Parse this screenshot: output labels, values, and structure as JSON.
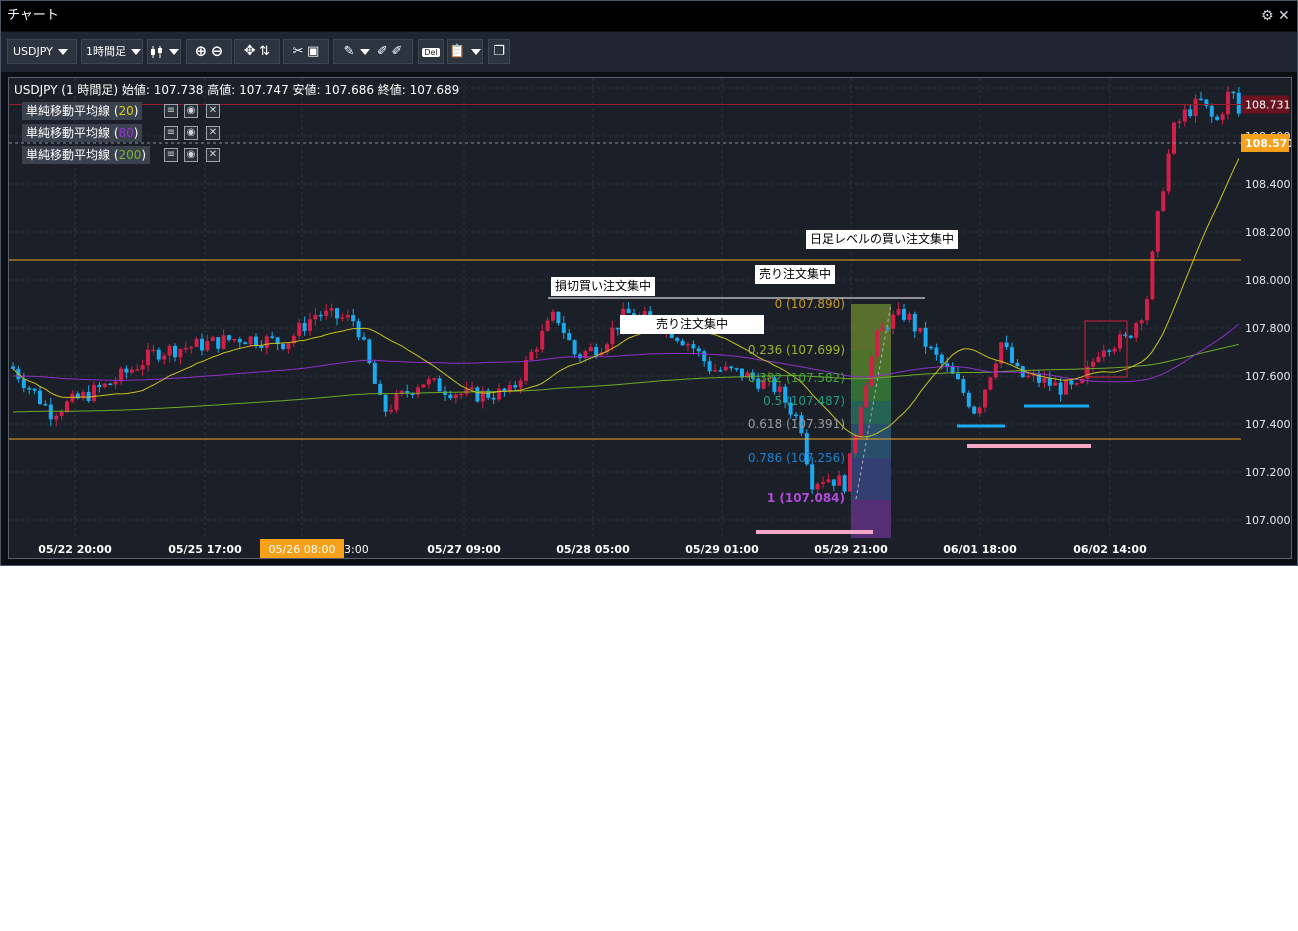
{
  "window": {
    "title": "チャート",
    "gear_icon": "gear-icon",
    "close_icon": "close-icon"
  },
  "toolbar": {
    "symbol": "USDJPY",
    "timeframe": "1時間足",
    "chart_type_icon": "candlestick-icon",
    "buttons": [
      "zoom-in-icon",
      "zoom-out-icon",
      "pan-icon",
      "crosshair-icon",
      "drawing-tool-icon",
      "save-icon",
      "pen-icon",
      "eraser-icon",
      "eraser-all-icon",
      "delete-icon",
      "clipboard-icon",
      "window-icon"
    ],
    "delete_label": "Del"
  },
  "chart": {
    "header": "USDJPY (1 時間足) 始値: 107.738 高値: 107.747 安値: 107.686 終値: 107.689",
    "indicators": [
      {
        "name": "単純移動平均線",
        "period": "20",
        "color": "#e0d000"
      },
      {
        "name": "単純移動平均線",
        "period": "80",
        "color": "#9b30d9"
      },
      {
        "name": "単純移動平均線",
        "period": "200",
        "color": "#7ab52a"
      }
    ],
    "price_labels": [
      "108.731",
      "108.600",
      "108.400",
      "108.200",
      "108.000",
      "107.800",
      "107.600",
      "107.400",
      "107.200",
      "107.000"
    ],
    "current_price": "108.571",
    "high_marker": "108.731",
    "time_labels": [
      "05/22 20:00",
      "05/25 17:00",
      "05/26 08:00",
      "05/27 09:00",
      "05/28 05:00",
      "05/29 01:00",
      "05/29 21:00",
      "06/01 18:00",
      "06/02 14:00"
    ],
    "time_overlap_fragment": "3:00",
    "notes": [
      "損切買い注文集中",
      "売り注文集中",
      "売り注文集中",
      "日足レベルの買い注文集中"
    ],
    "fib_levels": [
      {
        "label": "0 (107.890)",
        "color": "#c79a2e"
      },
      {
        "label": "0.236 (107.699)",
        "color": "#9fb42a"
      },
      {
        "label": "0.382 (107.582)",
        "color": "#41a834"
      },
      {
        "label": "0.5 (107.487)",
        "color": "#1f9c7a"
      },
      {
        "label": "0.618 (107.391)",
        "color": "#9a9a9a"
      },
      {
        "label": "0.786 (107.256)",
        "color": "#1f7fc8"
      },
      {
        "label": "1 (107.084)",
        "color": "#b04bd8"
      }
    ],
    "colors": {
      "up": "#d21f47",
      "down": "#1ba9f0",
      "sma20": "#c9c21c",
      "sma80": "#8e2fc9",
      "sma200": "#6ea82a",
      "hline": "#f0a020",
      "accent": "#f7a11a"
    }
  }
}
